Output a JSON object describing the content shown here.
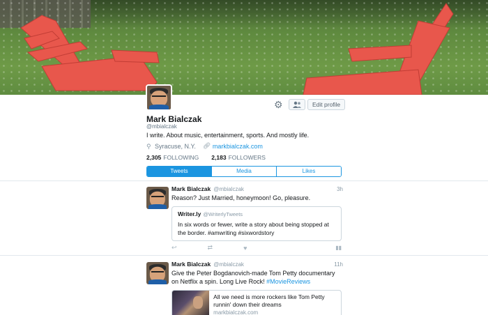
{
  "profile": {
    "name": "Mark Bialczak",
    "handle": "@mbialczak",
    "bio": "I write. About music, entertainment, sports. And mostly life.",
    "location": "Syracuse, N.Y.",
    "website": "markbialczak.com",
    "following_count": "2,305",
    "following_label": "FOLLOWING",
    "followers_count": "2,183",
    "followers_label": "FOLLOWERS",
    "edit_profile_label": "Edit profile"
  },
  "tabs": [
    {
      "label": "Tweets",
      "active": true
    },
    {
      "label": "Media",
      "active": false
    },
    {
      "label": "Likes",
      "active": false
    }
  ],
  "tweets": [
    {
      "author": "Mark Bialczak",
      "handle": "@mbialczak",
      "time": "3h",
      "text": "Reason? Just Married, honeymoon! Go, pleasure.",
      "quote": {
        "author": "Writer.ly",
        "handle": "@WriterlyTweets",
        "text": "In six words or fewer, write a story about being stopped at the border. #amwriting #sixwordstory"
      }
    },
    {
      "author": "Mark Bialczak",
      "handle": "@mbialczak",
      "time": "11h",
      "text_main": "Give the Peter Bogdanovich-made Tom Petty documentary on Netflix a spin. Long Live Rock!",
      "hashtag": "#MovieReviews",
      "card": {
        "title": "All we need is more rockers like Tom Petty runnin' down their dreams",
        "domain": "markbialczak.com"
      }
    }
  ],
  "colors": {
    "accent": "#1b95e0",
    "secondary_text": "#657786"
  }
}
